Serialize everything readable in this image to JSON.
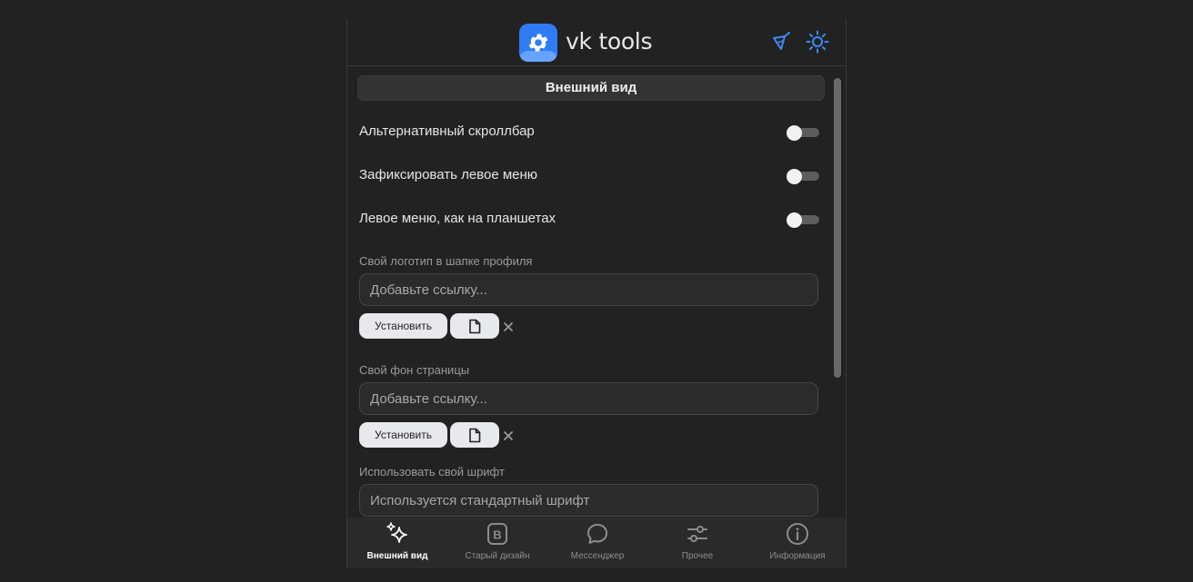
{
  "header": {
    "app_title": "vk tools",
    "logo_icon": "gear-icon",
    "actions": [
      {
        "name": "clean-icon"
      },
      {
        "name": "sun-icon"
      }
    ]
  },
  "section": {
    "title": "Внешний вид"
  },
  "toggles": [
    {
      "label": "Альтернативный скроллбар",
      "on": false
    },
    {
      "label": "Зафиксировать левое меню",
      "on": false
    },
    {
      "label": "Левое меню, как на планшетах",
      "on": false
    }
  ],
  "logo_field": {
    "label": "Свой логотип в шапке профиля",
    "placeholder": "Добавьте ссылку...",
    "value": "",
    "set_button": "Установить"
  },
  "background_field": {
    "label": "Свой фон страницы",
    "placeholder": "Добавьте ссылку...",
    "value": "",
    "set_button": "Установить"
  },
  "font_field": {
    "label": "Использовать свой шрифт",
    "placeholder": "Используется стандартный шрифт",
    "value": ""
  },
  "tabs": [
    {
      "label": "Внешний вид",
      "icon": "sparkles-icon",
      "active": true
    },
    {
      "label": "Старый дизайн",
      "icon": "b-badge-icon",
      "active": false
    },
    {
      "label": "Мессенджер",
      "icon": "chat-bubble-icon",
      "active": false
    },
    {
      "label": "Прочее",
      "icon": "sliders-icon",
      "active": false
    },
    {
      "label": "Информация",
      "icon": "info-icon",
      "active": false
    }
  ],
  "colors": {
    "accent": "#2f7cf6",
    "icon_blue": "#3d8af7",
    "background": "#222222"
  }
}
